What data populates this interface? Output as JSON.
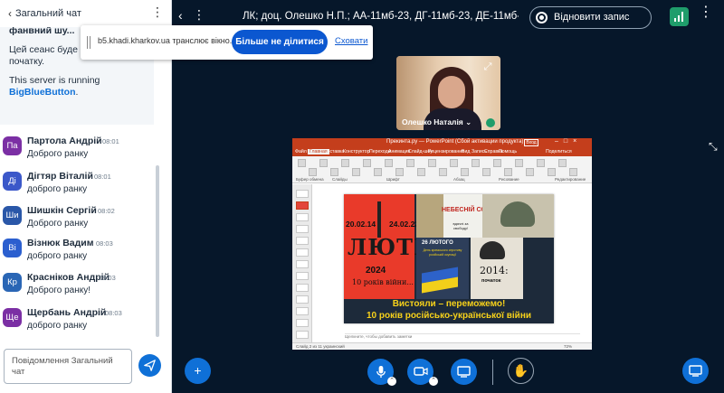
{
  "chat": {
    "title": "Загальний чат",
    "welcome_cut": "фанвний шу...",
    "welcome_line1": "Цей сеанс буде записано під початку.",
    "welcome_line2": "This server is running",
    "welcome_link": "BigBlueButton",
    "welcome_link_suffix": ".",
    "messages": [
      {
        "initials": "Па",
        "color": "#7b2fa4",
        "name": "Партола Андрій",
        "time": "08:01",
        "text": "Доброго ранку"
      },
      {
        "initials": "Ді",
        "color": "#3b58c9",
        "name": "Дігтяр Віталій",
        "time": "08:01",
        "text": "доброго ранку"
      },
      {
        "initials": "Ши",
        "color": "#2a57a8",
        "name": "Шишкін Сергій",
        "time": "08:02",
        "text": "Доброго ранку"
      },
      {
        "initials": "Ві",
        "color": "#2b5fcf",
        "name": "Візнюк Вадим",
        "time": "08:03",
        "text": "доброго ранку"
      },
      {
        "initials": "Кр",
        "color": "#2a66b5",
        "name": "Краснiков Андрiй",
        "time": "08:03",
        "text": "Доброго ранку!"
      },
      {
        "initials": "Ще",
        "color": "#7b2fa4",
        "name": "Щербань Андрій",
        "time": "08:03",
        "text": "доброго ранку"
      }
    ],
    "input_placeholder": "Повідомлення Загальний чат"
  },
  "topbar": {
    "meeting_title": "ЛК; доц. Олешко Н.П.; АА-11мб-23, ДГ-11мб-23, ДЕ-11мб-23, МА-11...",
    "record_label": "Відновити запис"
  },
  "share_banner": {
    "text": "b5.khadi.kharkov.ua транслює вікно.",
    "stop_label": "Більше не ділитися",
    "hide_label": "Сховати"
  },
  "webcam": {
    "name": "Олешко Наталія"
  },
  "ppt": {
    "title": "Прекинта.ру — PowerPoint (Сбой активации продукта)",
    "login": "Вход",
    "tabs": [
      "Файл",
      "Главная",
      "Вставка",
      "Конструктор",
      "Переходы",
      "Анимация",
      "Слайд-шоу",
      "Рецензирование",
      "Вид",
      "Запись",
      "Справка",
      "Помощь",
      "Поделиться"
    ],
    "ribbon_groups": [
      "Буфер обмена",
      "Слайды",
      "Шрифт",
      "Абзац",
      "Рисование",
      "Редактирование"
    ],
    "notes_placeholder": "Щелкните, чтобы добавить заметки",
    "status": "Слайд 2 из 11    украинский",
    "zoom": "72%"
  },
  "slide": {
    "date_left": "20.02.14",
    "date_right": "24.02.22",
    "poster_word": "ЛЮТИЙ",
    "poster_year": "2024",
    "poster_years": "10 років війни...",
    "sotni_title": "НЕБЕСНІЙ СОТНІ",
    "sotni_sub": "вдячні за свободу!",
    "flag_date": "26 ЛЮТОГО",
    "flag_text": "День кримського спротиву російській окупації",
    "year_2014": "2014:",
    "pochatok": "початок",
    "line1": "Вистояли – переможемо!",
    "line2": "10 років російсько-української війни"
  },
  "colors": {
    "background": "#06172a",
    "accent": "#0f70d7",
    "ppt_red": "#c43e1c",
    "connection_green": "#1f9d6b"
  }
}
